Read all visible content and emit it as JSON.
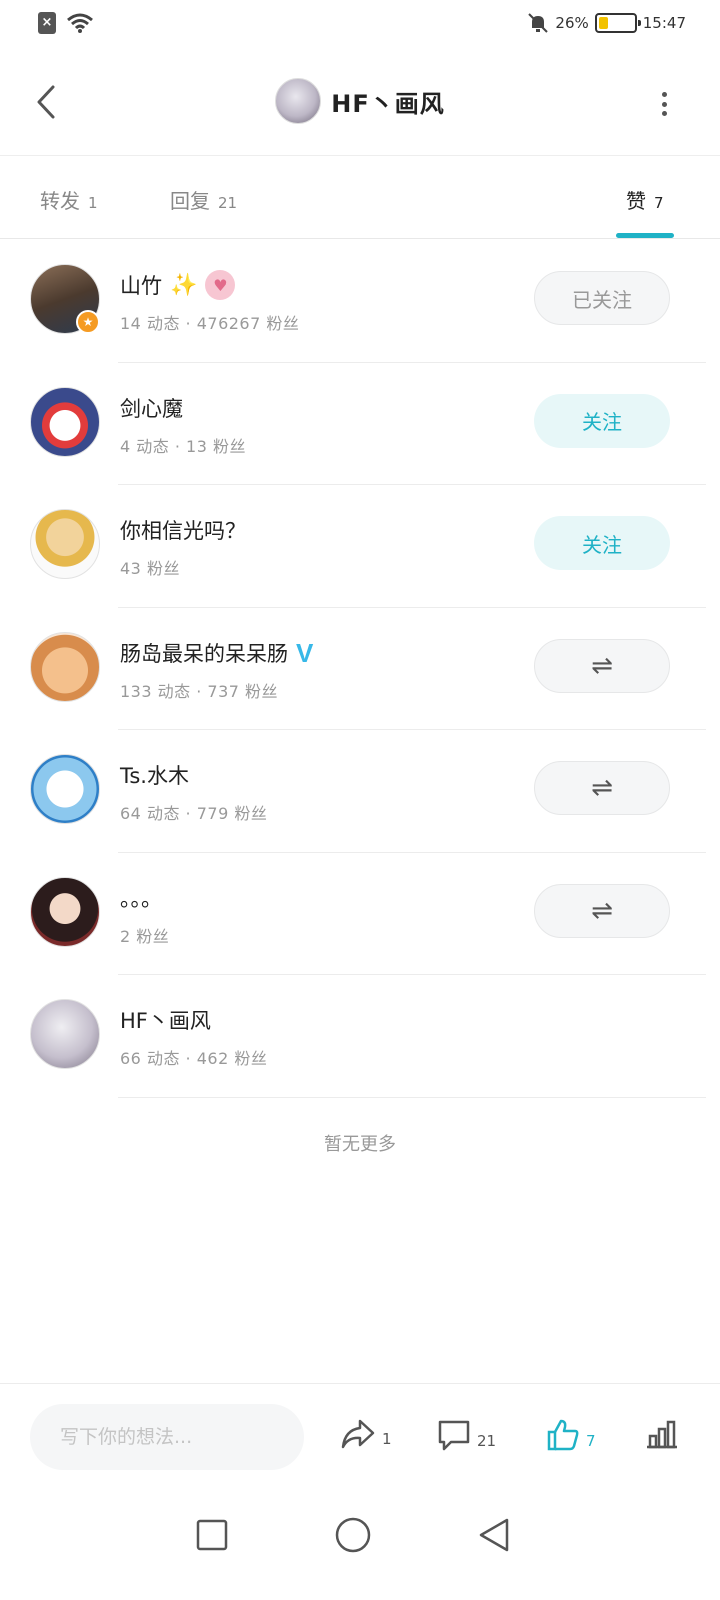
{
  "status_bar": {
    "battery": "26%",
    "time": "15:47",
    "battery_level": 0.26,
    "sim_label": "×"
  },
  "header": {
    "title": "HF丶画风"
  },
  "tabs": [
    {
      "label": "转发",
      "count": "1"
    },
    {
      "label": "回复",
      "count": "21"
    },
    {
      "label": "赞",
      "count": "7"
    }
  ],
  "users": [
    {
      "name": "山竹",
      "meta": "14 动态 · 476267 粉丝",
      "button": "已关注",
      "button_type": "followed"
    },
    {
      "name": "剑心魔",
      "meta": "4 动态 · 13 粉丝",
      "button": "关注",
      "button_type": "follow"
    },
    {
      "name": "你相信光吗？",
      "meta": "43 粉丝",
      "button": "关注",
      "button_type": "follow"
    },
    {
      "name": "肠岛最呆的呆呆肠",
      "meta": "133 动态 · 737 粉丝",
      "button": "⇌",
      "button_type": "mutual"
    },
    {
      "name": "Ts.水木",
      "meta": "64 动态 · 779 粉丝",
      "button": "⇌",
      "button_type": "mutual"
    },
    {
      "name": "。。。",
      "meta": "2 粉丝",
      "button": "⇌",
      "button_type": "mutual"
    },
    {
      "name": "HF丶画风",
      "meta": "66 动态 · 462 粉丝"
    }
  ],
  "badges": {
    "sparkle": "✨",
    "v": "V"
  },
  "no_more": "暂无更多",
  "bottom_bar": {
    "placeholder": "写下你的想法...",
    "share_count": "1",
    "comment_count": "21",
    "like_count": "7"
  },
  "colors": {
    "accent": "#1fb2c6",
    "badge_orange": "#f59b23"
  }
}
